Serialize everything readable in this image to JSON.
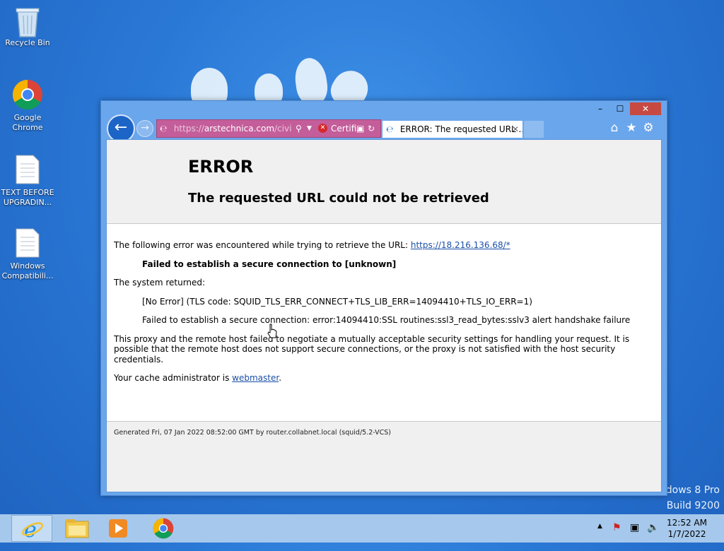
{
  "desktop": {
    "icons": [
      {
        "label": "Recycle Bin"
      },
      {
        "label": "Google Chrome"
      },
      {
        "label": "TEXT BEFORE UPGRADIN..."
      },
      {
        "label": "Windows Compatibili..."
      }
    ],
    "watermark_line1": "ndows 8 Pro",
    "watermark_line2": "Build 9200"
  },
  "browser": {
    "address": {
      "scheme": "https://",
      "host": "arstechnica.com",
      "rest": "/civi"
    },
    "cert_label": "Certifi...",
    "tab_title": "ERROR: The requested URL ...",
    "controls": {
      "minimize": "–",
      "maximize": "☐",
      "close": "✕"
    }
  },
  "page": {
    "title": "ERROR",
    "subtitle": "The requested URL could not be retrieved",
    "intro": "The following error was encountered while trying to retrieve the URL: ",
    "url": "https://18.216.136.68/*",
    "failed_strong": "Failed to establish a secure connection to [unknown]",
    "system_returned": "The system returned:",
    "no_error": "[No Error] (TLS code: SQUID_TLS_ERR_CONNECT+TLS_LIB_ERR=14094410+TLS_IO_ERR=1)",
    "failed_detail": "Failed to establish a secure connection: error:14094410:SSL routines:ssl3_read_bytes:sslv3 alert handshake failure",
    "explanation": "This proxy and the remote host failed to negotiate a mutually acceptable security settings for handling your request. It is possible that the remote host does not support secure connections, or the proxy is not satisfied with the host security credentials.",
    "admin_prefix": "Your cache administrator is ",
    "admin_link": "webmaster",
    "admin_suffix": ".",
    "footer": "Generated Fri, 07 Jan 2022 08:52:00 GMT by router.collabnet.local (squid/5.2-VCS)"
  },
  "taskbar": {
    "apps": [
      "internet-explorer",
      "file-explorer",
      "media-player",
      "google-chrome"
    ],
    "time": "12:52 AM",
    "date": "1/7/2022"
  },
  "colors": {
    "address_bar_error": "#c45e9b",
    "link": "#1a4fa8",
    "close_button": "#c74a42"
  }
}
